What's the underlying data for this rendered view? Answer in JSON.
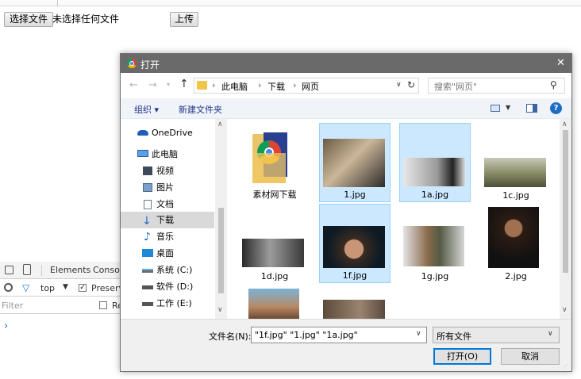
{
  "page": {
    "choose_file_label": "选择文件",
    "no_file_text": "未选择任何文件",
    "upload_label": "上传"
  },
  "devtools": {
    "tab_elements": "Elements",
    "tab_console": "Console",
    "context_label": "top",
    "preserve_label": "Preserve",
    "filter_placeholder": "Filter",
    "regex_label": "Re",
    "prompt_symbol": "›"
  },
  "dialog": {
    "title": "打开",
    "close_glyph": "✕",
    "breadcrumb": [
      "此电脑",
      "下载",
      "网页"
    ],
    "search_placeholder": "搜索\"网页\"",
    "organize_label": "组织 ▾",
    "new_folder_label": "新建文件夹",
    "help_glyph": "?",
    "nav_items": [
      {
        "label": "OneDrive",
        "icon": "cloud-icon"
      },
      {
        "label": "此电脑",
        "icon": "computer-icon"
      },
      {
        "label": "视频",
        "icon": "video-folder-icon"
      },
      {
        "label": "图片",
        "icon": "picture-folder-icon"
      },
      {
        "label": "文档",
        "icon": "document-folder-icon"
      },
      {
        "label": "下载",
        "icon": "download-folder-icon",
        "selected": true
      },
      {
        "label": "音乐",
        "icon": "music-folder-icon"
      },
      {
        "label": "桌面",
        "icon": "desktop-folder-icon"
      },
      {
        "label": "系统 (C:)",
        "icon": "system-drive-icon"
      },
      {
        "label": "软件 (D:)",
        "icon": "drive-icon"
      },
      {
        "label": "工作 (E:)",
        "icon": "drive-icon"
      }
    ],
    "files": [
      {
        "name": "素材网下载",
        "type": "folder",
        "selected": false
      },
      {
        "name": "1.jpg",
        "type": "image",
        "selected": true
      },
      {
        "name": "1a.jpg",
        "type": "image",
        "selected": true
      },
      {
        "name": "1c.jpg",
        "type": "image",
        "selected": false
      },
      {
        "name": "1d.jpg",
        "type": "image",
        "selected": false
      },
      {
        "name": "1f.jpg",
        "type": "image",
        "selected": true
      },
      {
        "name": "1g.jpg",
        "type": "image",
        "selected": false
      },
      {
        "name": "2.jpg",
        "type": "image",
        "selected": false
      }
    ],
    "filename_label": "文件名(N):",
    "filename_value": "\"1f.jpg\" \"1.jpg\" \"1a.jpg\"",
    "filetype_value": "所有文件",
    "open_label": "打开(O)",
    "cancel_label": "取消"
  },
  "colors": {
    "title_bar": "#6a6a6a",
    "selection_bg": "#cce8ff",
    "selection_border": "#99d1ff",
    "accent_blue": "#0078d7",
    "nav_selected": "#d9d9d9"
  }
}
